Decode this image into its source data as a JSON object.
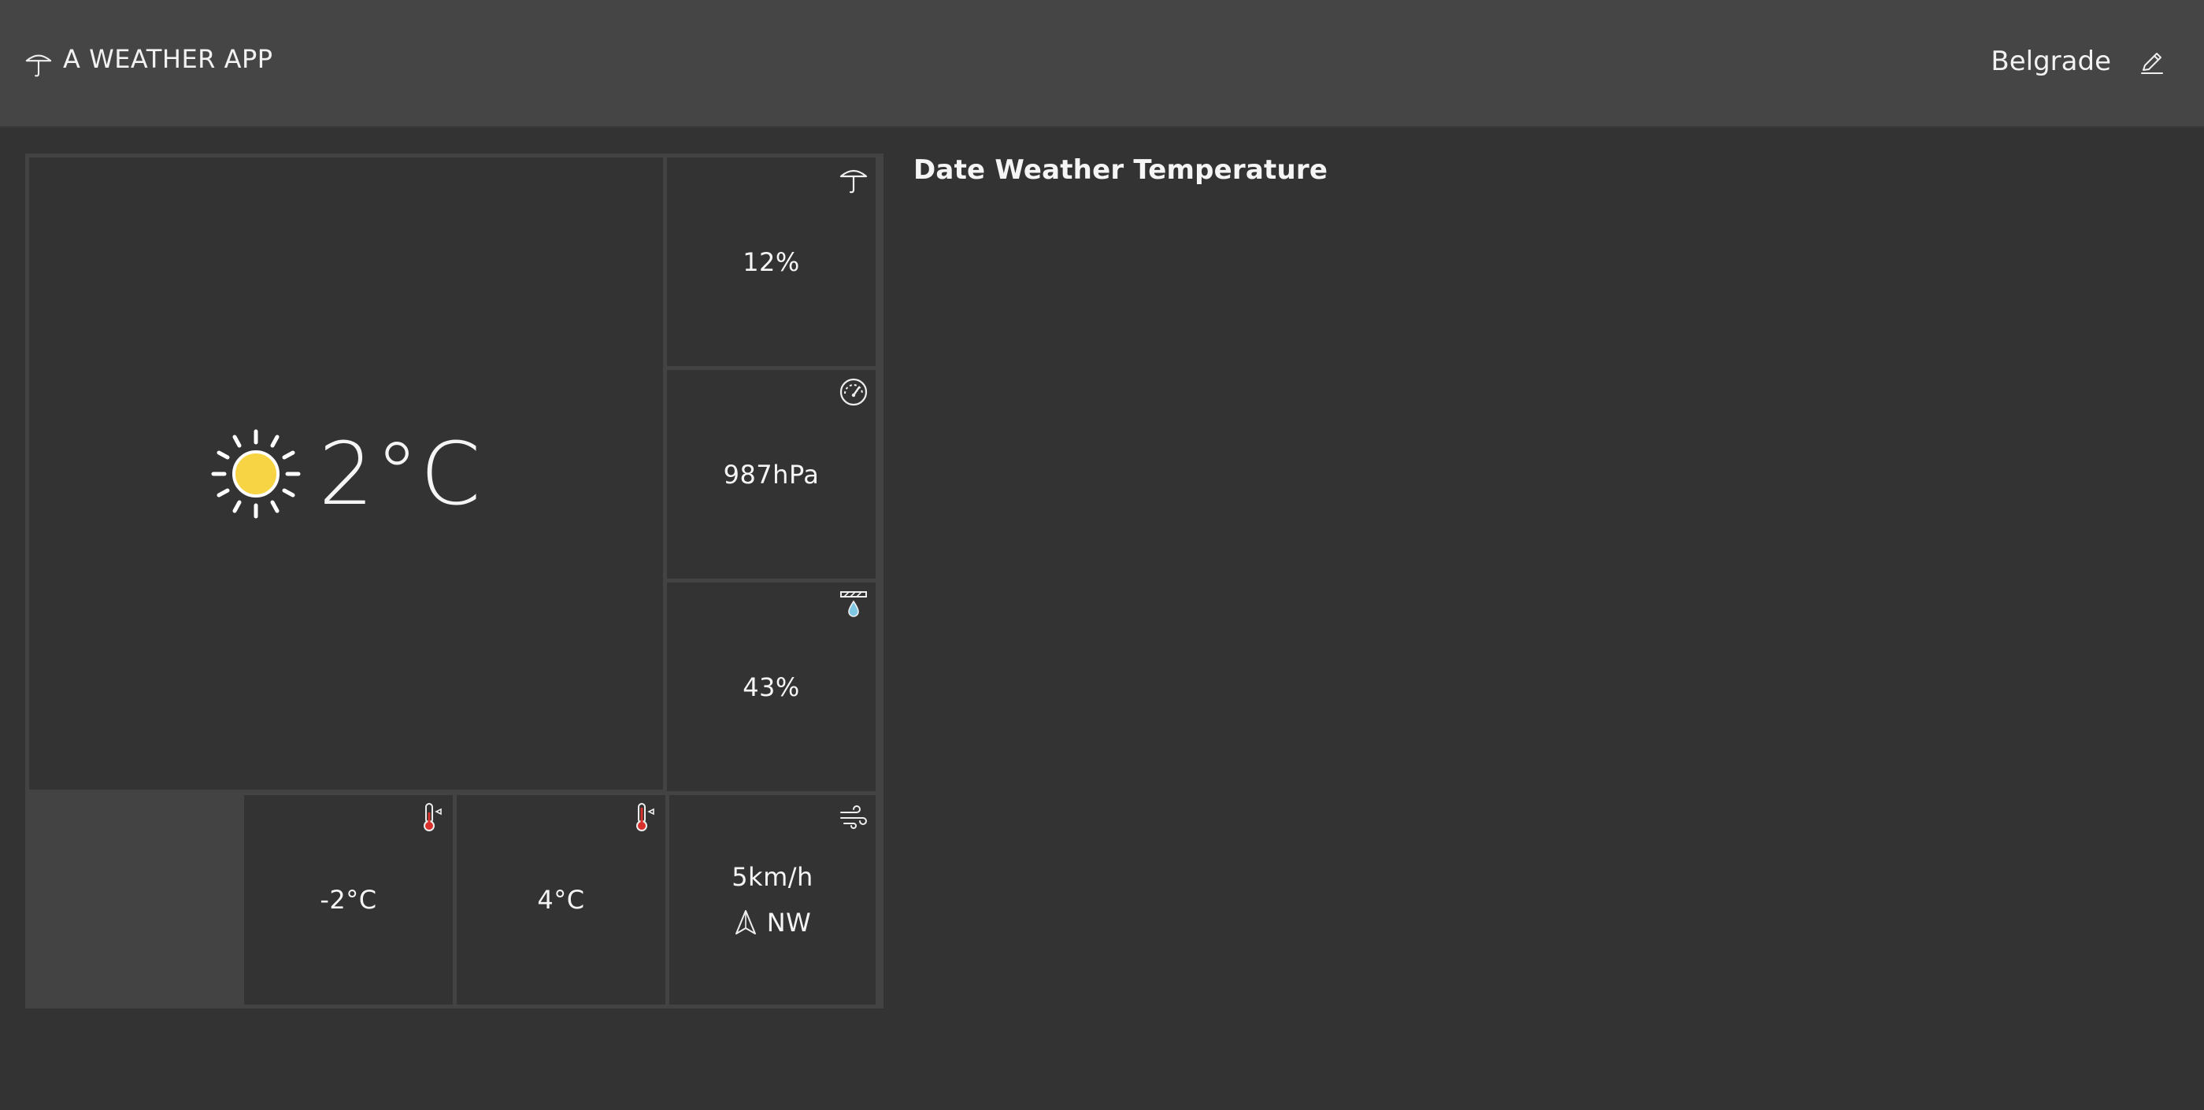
{
  "header": {
    "logo_icon": "umbrella-icon",
    "title": "A WEATHER APP",
    "city": "Belgrade",
    "edit_icon": "pencil-icon"
  },
  "current": {
    "condition_icon": "sun-icon",
    "temperature": "2°C"
  },
  "tiles": {
    "precipitation": {
      "icon": "umbrella-icon",
      "value": "12%"
    },
    "pressure": {
      "icon": "gauge-icon",
      "value": "987hPa"
    },
    "humidity": {
      "icon": "humidity-drop-icon",
      "value": "43%"
    },
    "min_temp": {
      "icon": "thermometer-low-icon",
      "value": "-2°C"
    },
    "max_temp": {
      "icon": "thermometer-high-icon",
      "value": "4°C"
    },
    "wind": {
      "icon": "wind-icon",
      "speed": "5km/h",
      "direction_icon": "navigation-arrow-icon",
      "direction": "NW"
    }
  },
  "forecast_table": {
    "headers": [
      "Date",
      "Weather",
      "Temperature"
    ]
  },
  "colors": {
    "background": "#333333",
    "header": "#454545",
    "sun": "#f7d443",
    "thermometer": "#d9312b",
    "drop": "#7ec8e3"
  }
}
